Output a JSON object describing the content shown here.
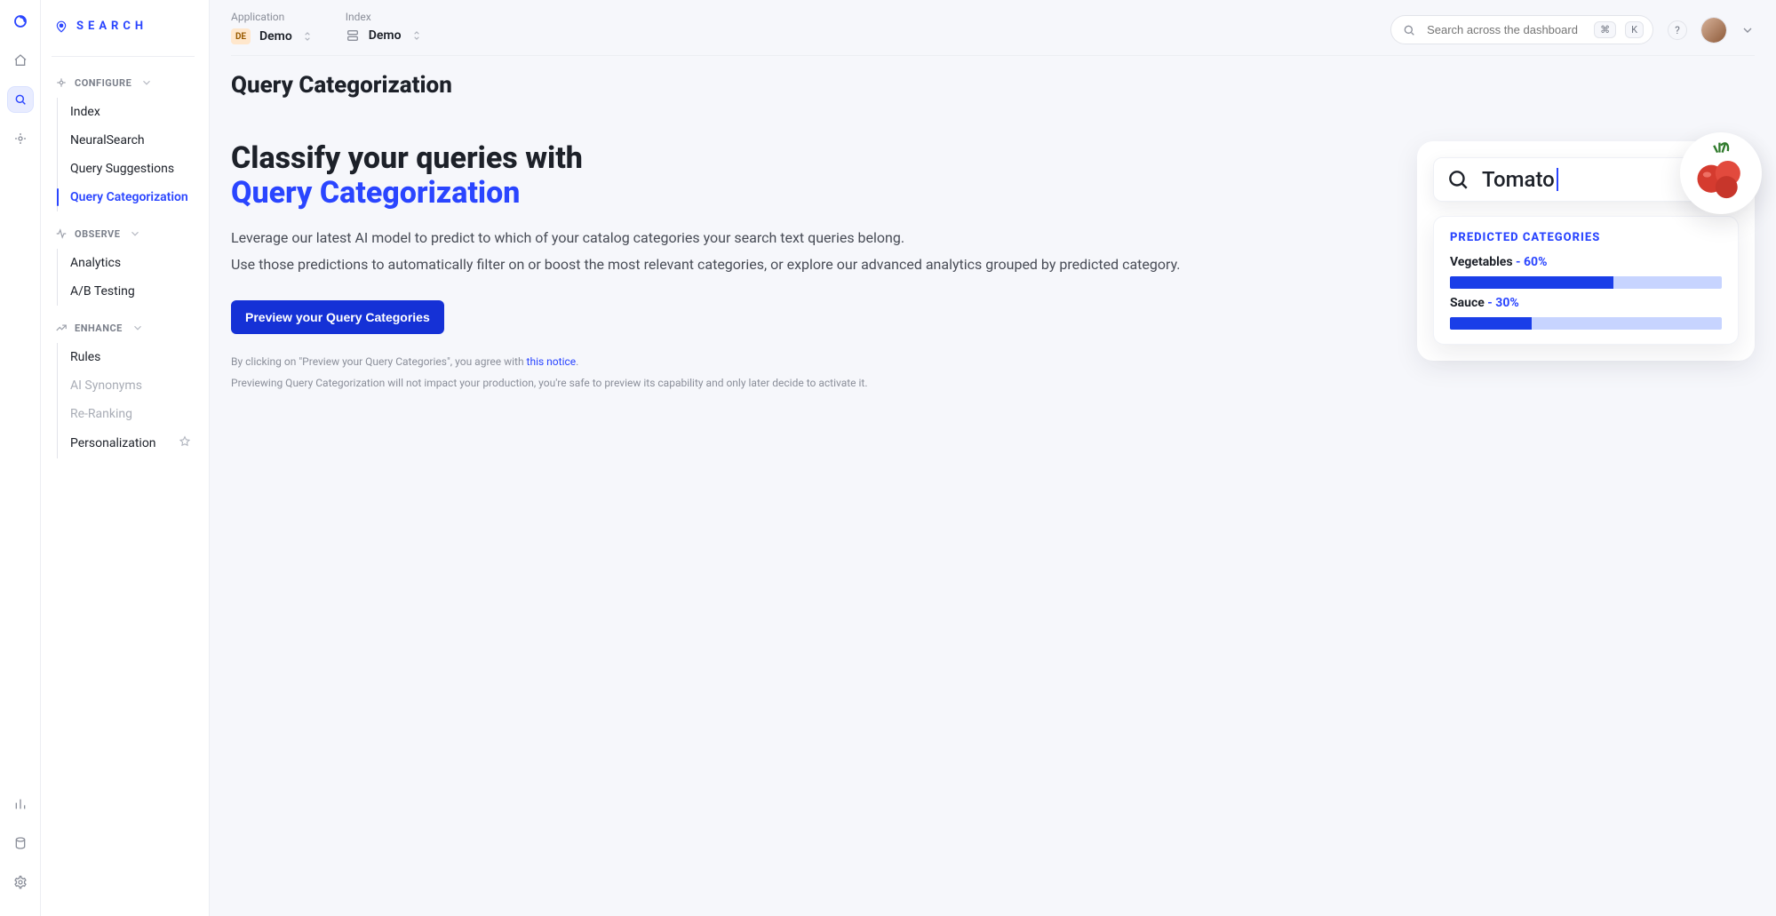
{
  "brand": "SEARCH",
  "sidebar": {
    "sections": [
      {
        "key": "configure",
        "title": "CONFIGURE",
        "items": [
          {
            "label": "Index"
          },
          {
            "label": "NeuralSearch"
          },
          {
            "label": "Query Suggestions"
          },
          {
            "label": "Query Categorization",
            "active": true
          }
        ]
      },
      {
        "key": "observe",
        "title": "OBSERVE",
        "items": [
          {
            "label": "Analytics"
          },
          {
            "label": "A/B Testing"
          }
        ]
      },
      {
        "key": "enhance",
        "title": "ENHANCE",
        "items": [
          {
            "label": "Rules"
          },
          {
            "label": "AI Synonyms",
            "muted": true
          },
          {
            "label": "Re-Ranking",
            "muted": true
          },
          {
            "label": "Personalization",
            "star": true
          }
        ]
      }
    ]
  },
  "breadcrumbs": {
    "application": {
      "label": "Application",
      "value": "Demo",
      "badge": "DE"
    },
    "index": {
      "label": "Index",
      "value": "Demo"
    }
  },
  "search": {
    "placeholder": "Search across the dashboard",
    "shortcut": "K"
  },
  "page": {
    "title": "Query Categorization",
    "hero": {
      "h2a": "Classify your queries with",
      "h2b": "Query Categorization",
      "p1": "Leverage our latest AI model to predict to which of your catalog categories your search text queries belong.",
      "p2": "Use those predictions to automatically filter on or boost the most relevant categories, or explore our advanced analytics grouped by predicted category.",
      "cta": "Preview your Query Categories",
      "legal1_pre": "By clicking on \"Preview your Query Categories\", you agree with ",
      "legal1_link": "this notice",
      "legal1_post": ".",
      "legal2": "Previewing Query Categorization will not impact your production, you're safe to preview its capability and only later decide to activate it."
    }
  },
  "preview": {
    "query": "Tomato",
    "heading": "PREDICTED CATEGORIES",
    "categories": [
      {
        "name": "Vegetables",
        "pct": 60
      },
      {
        "name": "Sauce",
        "pct": 30
      }
    ]
  }
}
